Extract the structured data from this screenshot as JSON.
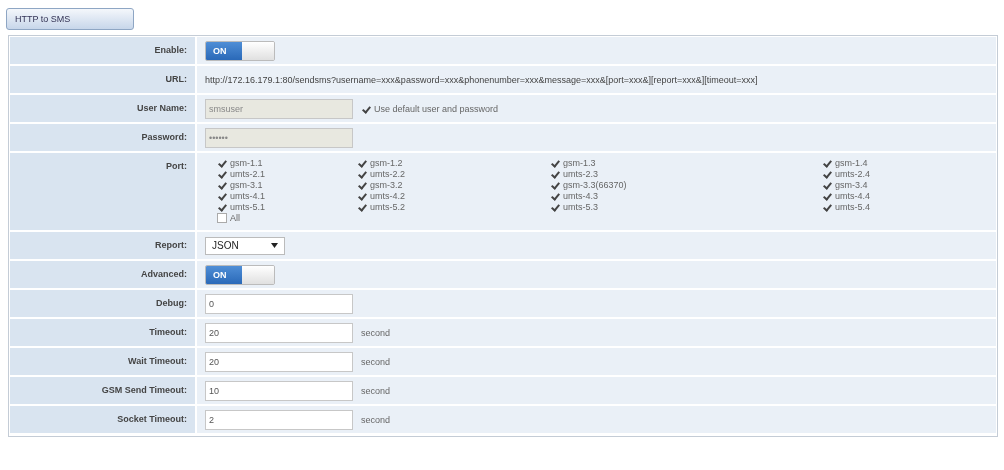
{
  "tab": {
    "label": "HTTP to SMS",
    "selected": true
  },
  "rows": [
    {
      "kind": "toggle",
      "label": "Enable:",
      "on": true,
      "on_label": "ON"
    },
    {
      "kind": "text",
      "label": "URL:",
      "value": "http://172.16.179.1:80/sendsms?username=xxx&password=xxx&phonenumber=xxx&message=xxx&[port=xxx&][report=xxx&][timeout=xxx]"
    },
    {
      "kind": "field",
      "label": "User Name:",
      "value": "smsuser",
      "disabled": true,
      "check": {
        "label": "Use default user and password",
        "checked": true
      }
    },
    {
      "kind": "field",
      "label": "Password:",
      "value": "••••••",
      "disabled": true
    },
    {
      "kind": "ports",
      "label": "Port:",
      "ports": [
        {
          "label": "gsm-1.1",
          "checked": true
        },
        {
          "label": "gsm-1.2",
          "checked": true
        },
        {
          "label": "gsm-1.3",
          "checked": true
        },
        {
          "label": "gsm-1.4",
          "checked": true
        },
        {
          "label": "umts-2.1",
          "checked": true
        },
        {
          "label": "umts-2.2",
          "checked": true
        },
        {
          "label": "umts-2.3",
          "checked": true
        },
        {
          "label": "umts-2.4",
          "checked": true
        },
        {
          "label": "gsm-3.1",
          "checked": true
        },
        {
          "label": "gsm-3.2",
          "checked": true
        },
        {
          "label": "gsm-3.3(66370)",
          "checked": true
        },
        {
          "label": "gsm-3.4",
          "checked": true
        },
        {
          "label": "umts-4.1",
          "checked": true
        },
        {
          "label": "umts-4.2",
          "checked": true
        },
        {
          "label": "umts-4.3",
          "checked": true
        },
        {
          "label": "umts-4.4",
          "checked": true
        },
        {
          "label": "umts-5.1",
          "checked": true
        },
        {
          "label": "umts-5.2",
          "checked": true
        },
        {
          "label": "umts-5.3",
          "checked": true
        },
        {
          "label": "umts-5.4",
          "checked": true
        }
      ],
      "all": {
        "label": "All",
        "checked": false
      }
    },
    {
      "kind": "select",
      "label": "Report:",
      "value": "JSON"
    },
    {
      "kind": "toggle",
      "label": "Advanced:",
      "on": true,
      "on_label": "ON"
    },
    {
      "kind": "field",
      "label": "Debug:",
      "value": "0",
      "disabled": false
    },
    {
      "kind": "field",
      "label": "Timeout:",
      "value": "20",
      "disabled": false,
      "unit": "second"
    },
    {
      "kind": "field",
      "label": "Wait Timeout:",
      "value": "20",
      "disabled": false,
      "unit": "second"
    },
    {
      "kind": "field",
      "label": "GSM Send Timeout:",
      "value": "10",
      "disabled": false,
      "unit": "second"
    },
    {
      "kind": "field",
      "label": "Socket Timeout:",
      "value": "2",
      "disabled": false,
      "unit": "second"
    }
  ]
}
